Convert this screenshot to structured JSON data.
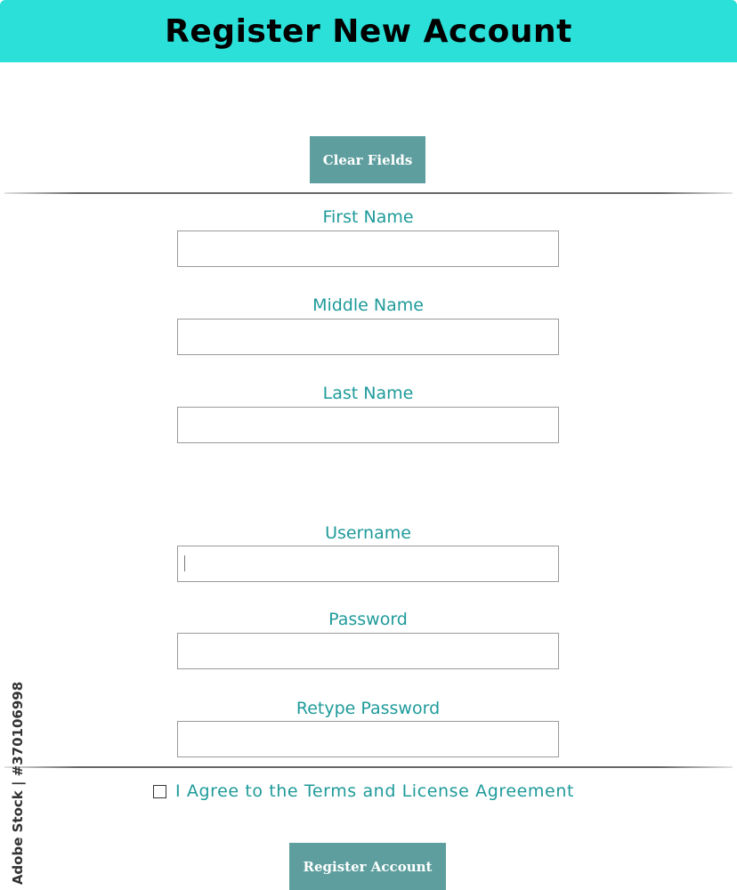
{
  "header": {
    "title": "Register New Account"
  },
  "actions": {
    "clear_label": "Clear Fields",
    "register_label": "Register Account"
  },
  "fields": [
    {
      "label": "First Name",
      "value": "",
      "type": "text"
    },
    {
      "label": "Middle Name",
      "value": "",
      "type": "text"
    },
    {
      "label": "Last Name",
      "value": "",
      "type": "text"
    },
    {
      "label": "Username",
      "value": "",
      "type": "text"
    },
    {
      "label": "Password",
      "value": "",
      "type": "password"
    },
    {
      "label": "Retype Password",
      "value": "",
      "type": "password"
    }
  ],
  "agreement": {
    "label": "I Agree to the Terms and License Agreement",
    "checked": false
  },
  "watermark": {
    "side_text": "Adobe Stock | #370106998"
  },
  "colors": {
    "header_bg": "#2ae0d8",
    "button_bg": "#5e9e9e",
    "label_color": "#1f9a9a"
  }
}
